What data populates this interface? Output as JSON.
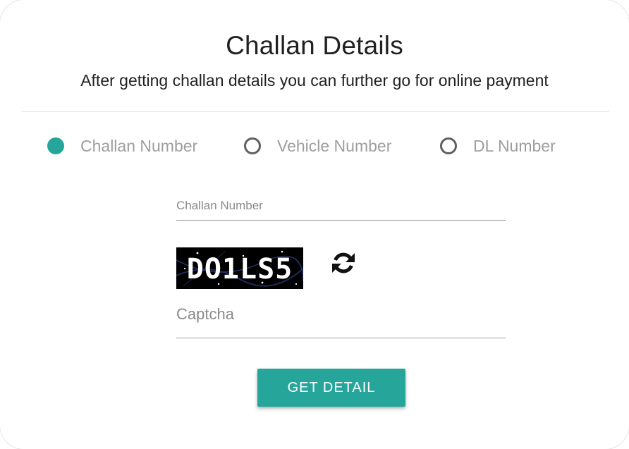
{
  "header": {
    "title": "Challan Details",
    "subtitle": "After getting challan details you can further go for online payment"
  },
  "search_type": {
    "options": [
      {
        "label": "Challan Number",
        "selected": true
      },
      {
        "label": "Vehicle Number",
        "selected": false
      },
      {
        "label": "DL Number",
        "selected": false
      }
    ]
  },
  "form": {
    "challan_field": {
      "placeholder": "Challan Number",
      "value": ""
    },
    "captcha_field": {
      "placeholder": "Captcha",
      "value": ""
    },
    "captcha_text": "DO1LS5",
    "refresh_icon": "refresh-icon",
    "submit_label": "GET DETAIL"
  },
  "colors": {
    "accent": "#26a69a",
    "text_primary": "#212121",
    "text_muted": "#9e9e9e",
    "captcha_bg": "#000000"
  }
}
